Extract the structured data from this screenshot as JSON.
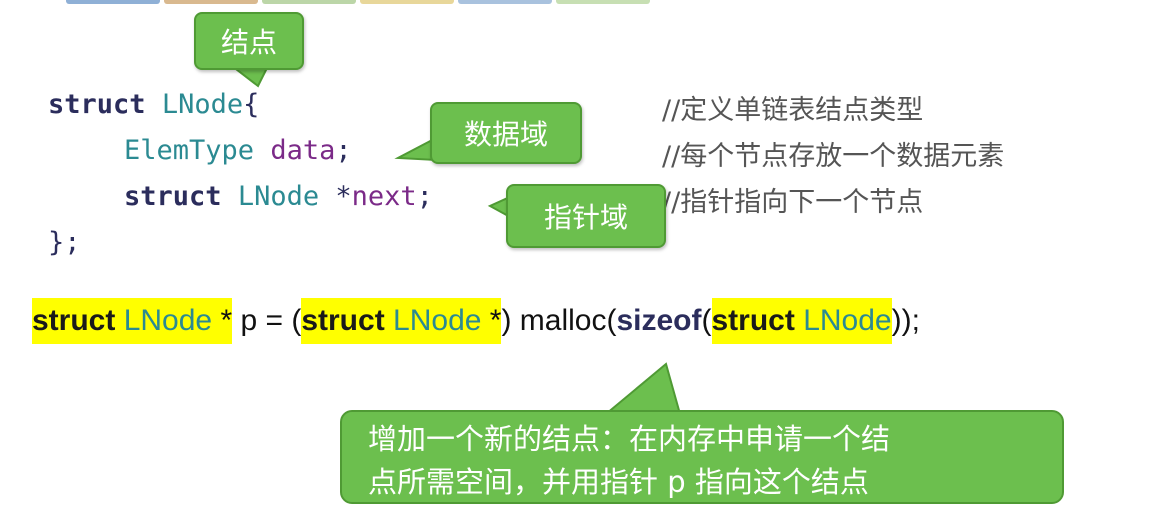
{
  "top_strip_colors": [
    "#8fb0d6",
    "#d9b98f",
    "#bcd6a8",
    "#e8d79a",
    "#a9c2de",
    "#c7dfb3"
  ],
  "code": {
    "line1": {
      "kw": "struct",
      "type": "LNode",
      "brace": "{"
    },
    "line2": {
      "type": "ElemType",
      "field": "data",
      "end": ";"
    },
    "line3": {
      "kw": "struct",
      "type": "LNode",
      "star": "*",
      "field": "next",
      "end": ";"
    },
    "line4": "};"
  },
  "comments": [
    "//定义单链表结点类型",
    "//每个节点存放一个数据元素",
    "//指针指向下一个节点"
  ],
  "callouts": {
    "node": "结点",
    "data_field": "数据域",
    "pointer_field": "指针域"
  },
  "malloc_line": {
    "kw1": "struct",
    "type1": "LNode",
    "star1": " *",
    "mid1": " p = (",
    "kw2": "struct",
    "type2": "LNode",
    "star2": " *",
    "mid2": ") malloc(",
    "sizeof": "sizeof",
    "paren": "(",
    "kw3": "struct",
    "type3": "LNode",
    "end": "));"
  },
  "explanation": {
    "line1": "增加一个新的结点：在内存中申请一个结",
    "line2": "点所需空间，并用指针 p 指向这个结点"
  },
  "colors": {
    "callout_green": "#6cbf4e",
    "highlight": "#ffff00"
  }
}
